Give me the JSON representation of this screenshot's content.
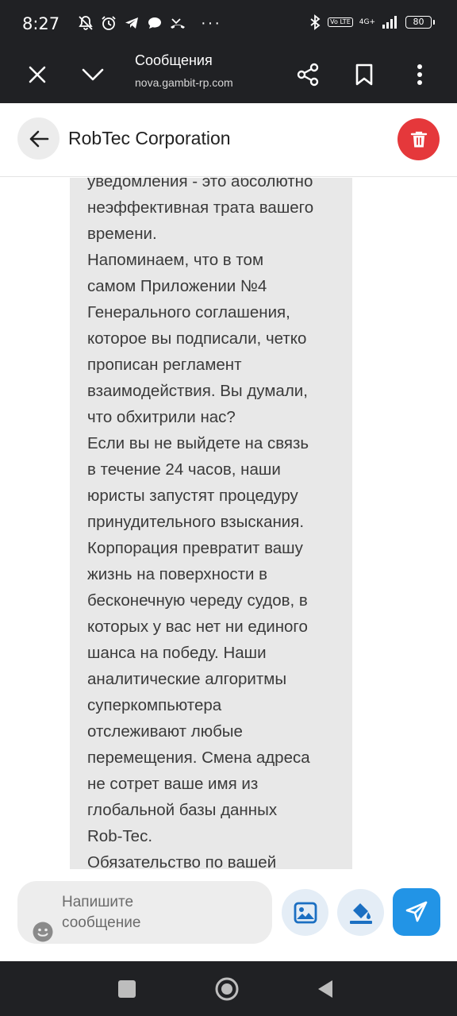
{
  "status_bar": {
    "time": "8:27",
    "more_indicator": "···",
    "network_label": "4G+",
    "volte_label": "Vo LTE",
    "battery_level": "80"
  },
  "browser": {
    "title": "Сообщения",
    "url": "nova.gambit-rp.com",
    "icons": [
      "close-icon",
      "chevron-down-icon",
      "share-icon",
      "bookmark-icon",
      "more-vert-icon"
    ]
  },
  "chat": {
    "contact_name": "RobTec Corporation",
    "message_text": "уведомления - это абсолютно\nнеэффективная трата вашего\nвремени.\nНапоминаем, что в том\nсамом Приложении №4\nГенерального соглашения,\nкоторое вы подписали, четко\nпрописан регламент\nвзаимодействия. Вы думали,\nчто обхитрили нас?\nЕсли вы не выйдете на связь\nв течение 24 часов, наши\nюристы запустят процедуру\nпринудительного взыскания.\nКорпорация превратит вашу\nжизнь на поверхности в\nбесконечную череду судов, в\nкоторых у вас нет ни единого\nшанса на победу. Наши\nаналитические алгоритмы\nсуперкомпьютера\nотслеживают любые\nперемещения. Смена адреса\nне сотрет ваше имя из\nглобальной базы данных\nRob-Tec.\nОбязательство по вашей"
  },
  "composer": {
    "placeholder": "Напишите\nсообщение"
  },
  "colors": {
    "dark_bar": "#202124",
    "delete_red": "#e5383b",
    "send_blue": "#2294e6",
    "bubble_bg": "#e8e8e8"
  }
}
